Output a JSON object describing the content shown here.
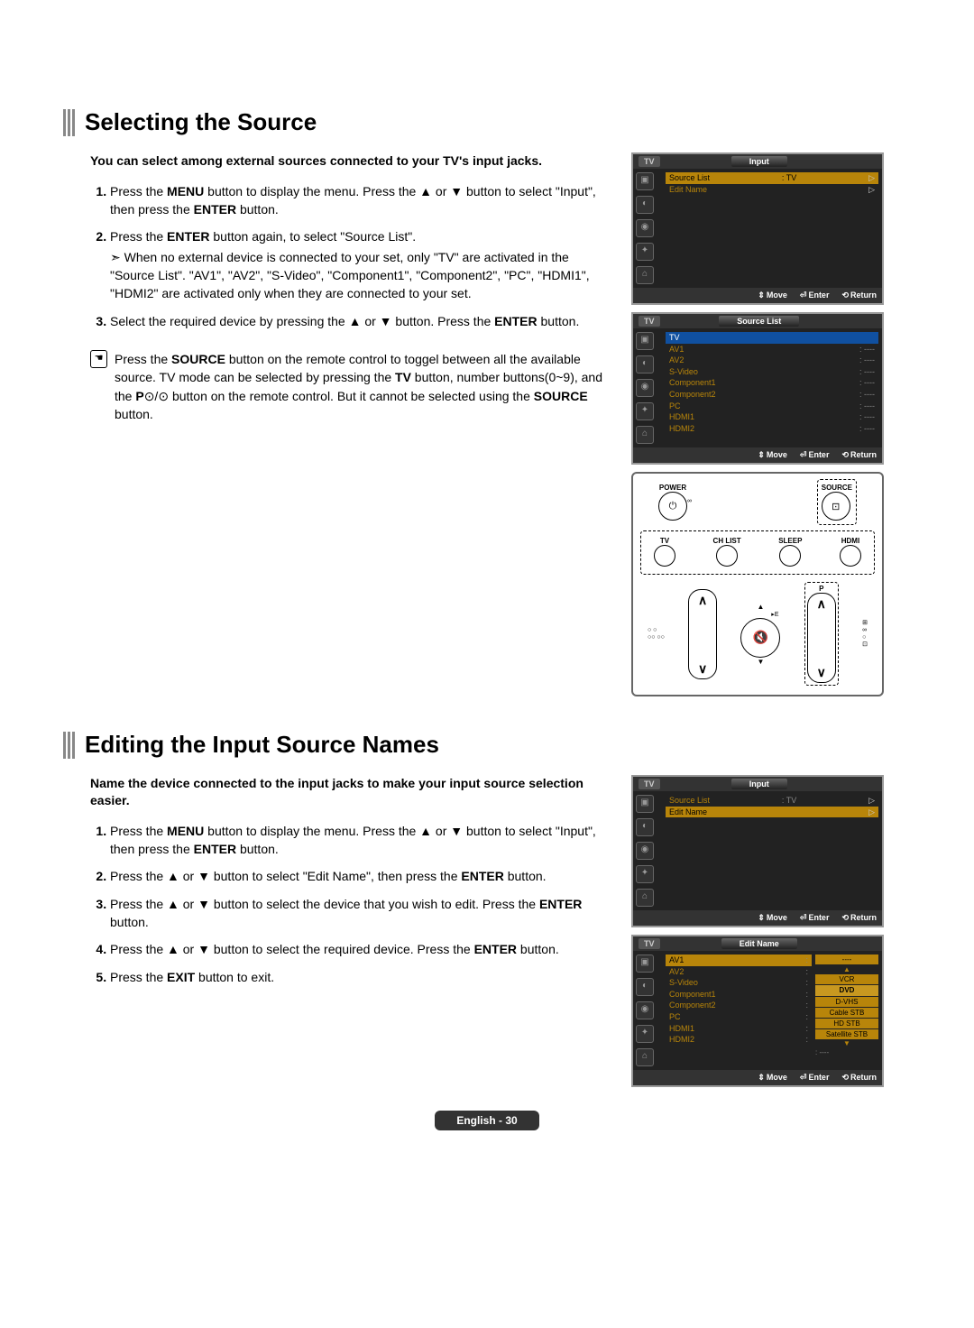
{
  "section1": {
    "title": "Selecting the Source",
    "lead": "You can select among external sources connected to your TV's input jacks.",
    "steps": [
      "Press the <b>MENU</b> button to display the menu. Press the ▲ or ▼ button to select \"Input\", then press the <b>ENTER</b> button.",
      "Press the <b>ENTER</b> button again, to select \"Source List\".",
      "Select the required device by pressing the ▲ or ▼ button. Press the <b>ENTER</b> button."
    ],
    "substep": "When no external device is connected to your set, only \"TV\" are activated in the \"Source List\". \"AV1\", \"AV2\", \"S-Video\", \"Component1\", \"Component2\", \"PC\", \"HDMI1\", \"HDMI2\" are activated only when they are connected to your set.",
    "note": "Press the <b>SOURCE</b> button on the remote control to toggel between all the available source. TV mode can be selected by pressing the <b>TV</b> button, number buttons(0~9), and the <b>P</b>⊙/⊙ button on the remote control. But it cannot be selected using the <b>SOURCE</b> button."
  },
  "section2": {
    "title": "Editing the Input Source Names",
    "lead": "Name the device connected to the input jacks to make your input source selection easier.",
    "steps": [
      "Press the <b>MENU</b> button to display the menu. Press the ▲ or ▼ button to select \"Input\", then press the <b>ENTER</b> button.",
      "Press the ▲ or ▼ button to select \"Edit Name\", then press the <b>ENTER</b> button.",
      "Press the ▲ or ▼ button to select the device that you wish to edit. Press the <b>ENTER</b> button.",
      "Press the ▲ or ▼ button to select the required device. Press the <b>ENTER</b> button.",
      "Press the <b>EXIT</b> button to exit."
    ]
  },
  "osd_strings": {
    "tv": "TV",
    "input": "Input",
    "sourcelist_label": "Source List",
    "editname_label": "Edit Name",
    "tv_value": ": TV",
    "move": "Move",
    "enter": "Enter",
    "return": "Return",
    "dashes": "----",
    "sourcelist_title": "Source List",
    "editname_title": "Edit Name",
    "sources": [
      "TV",
      "AV1",
      "AV2",
      "S-Video",
      "Component1",
      "Component2",
      "PC",
      "HDMI1",
      "HDMI2"
    ],
    "edit_sources": [
      "AV1",
      "AV2",
      "S-Video",
      "Component1",
      "Component2",
      "PC",
      "HDMI1",
      "HDMI2"
    ],
    "device_options_up": "▲",
    "device_options": [
      "VCR",
      "DVD",
      "D-VHS",
      "Cable STB",
      "HD STB",
      "Satellite STB"
    ],
    "device_options_down": "▼"
  },
  "remote": {
    "power": "POWER",
    "source": "SOURCE",
    "row4": [
      "TV",
      "CH LIST",
      "SLEEP",
      "HDMI"
    ],
    "p": "P",
    "e": "E"
  },
  "footer": "English - 30"
}
